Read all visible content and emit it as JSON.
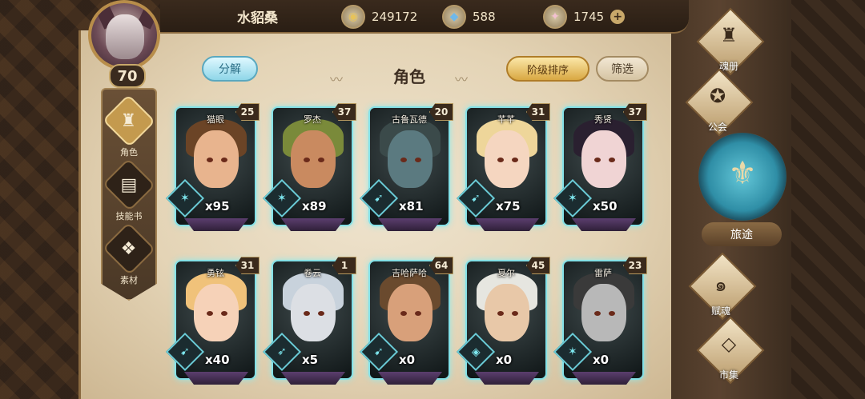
{
  "player": {
    "name": "水貂桑",
    "level": "70"
  },
  "resources": [
    {
      "icon": "gold-coin-icon",
      "symbol": "◉",
      "value": "249172"
    },
    {
      "icon": "blue-crystal-icon",
      "symbol": "◆",
      "value": "588"
    },
    {
      "icon": "pink-gem-icon",
      "symbol": "✦",
      "value": "1745"
    }
  ],
  "resources_plus": "+",
  "left_nav": [
    {
      "label": "角色",
      "icon": "character-helmet-icon",
      "symbol": "♜",
      "active": true
    },
    {
      "label": "技能书",
      "icon": "skill-book-icon",
      "symbol": "▤",
      "active": false
    },
    {
      "label": "素材",
      "icon": "material-icon",
      "symbol": "❖",
      "active": false
    }
  ],
  "header": {
    "decompose": "分解",
    "title": "角色",
    "sort": "阶级排序",
    "filter": "筛选"
  },
  "characters": [
    {
      "name": "猫眼",
      "level": "25",
      "count": "x95",
      "class_symbol": "✶",
      "hair": "#6b4426",
      "skin": "#e8b48e"
    },
    {
      "name": "罗杰",
      "level": "37",
      "count": "x89",
      "class_symbol": "✶",
      "hair": "#7a8a3a",
      "skin": "#c98a60"
    },
    {
      "name": "古鲁瓦德",
      "level": "20",
      "count": "x81",
      "class_symbol": "➹",
      "hair": "#3b4a4a",
      "skin": "#5b7a80"
    },
    {
      "name": "芊芊",
      "level": "31",
      "count": "x75",
      "class_symbol": "➹",
      "hair": "#eed69a",
      "skin": "#f5d6c0"
    },
    {
      "name": "秀贤",
      "level": "37",
      "count": "x50",
      "class_symbol": "✶",
      "hair": "#2a2030",
      "skin": "#f0d4d4"
    },
    {
      "name": "勇铉",
      "level": "31",
      "count": "x40",
      "class_symbol": "➹",
      "hair": "#f0c27a",
      "skin": "#f6d2b8"
    },
    {
      "name": "卷云",
      "level": "1",
      "count": "x5",
      "class_symbol": "➶",
      "hair": "#c8d2dc",
      "skin": "#dcdfe4"
    },
    {
      "name": "吉哈萨哈",
      "level": "64",
      "count": "x0",
      "class_symbol": "➹",
      "hair": "#6a4a2e",
      "skin": "#d8a07a"
    },
    {
      "name": "夏尔",
      "level": "45",
      "count": "x0",
      "class_symbol": "◈",
      "hair": "#e6e6e0",
      "skin": "#e8c8a8"
    },
    {
      "name": "雷萨",
      "level": "23",
      "count": "x0",
      "class_symbol": "✶",
      "hair": "#3a3a3a",
      "skin": "#b8b8b8"
    }
  ],
  "right_menu": {
    "soul_book": "魂册",
    "guild": "公会",
    "journey": "旅途",
    "soul_gift": "赋魂",
    "market": "市集"
  }
}
